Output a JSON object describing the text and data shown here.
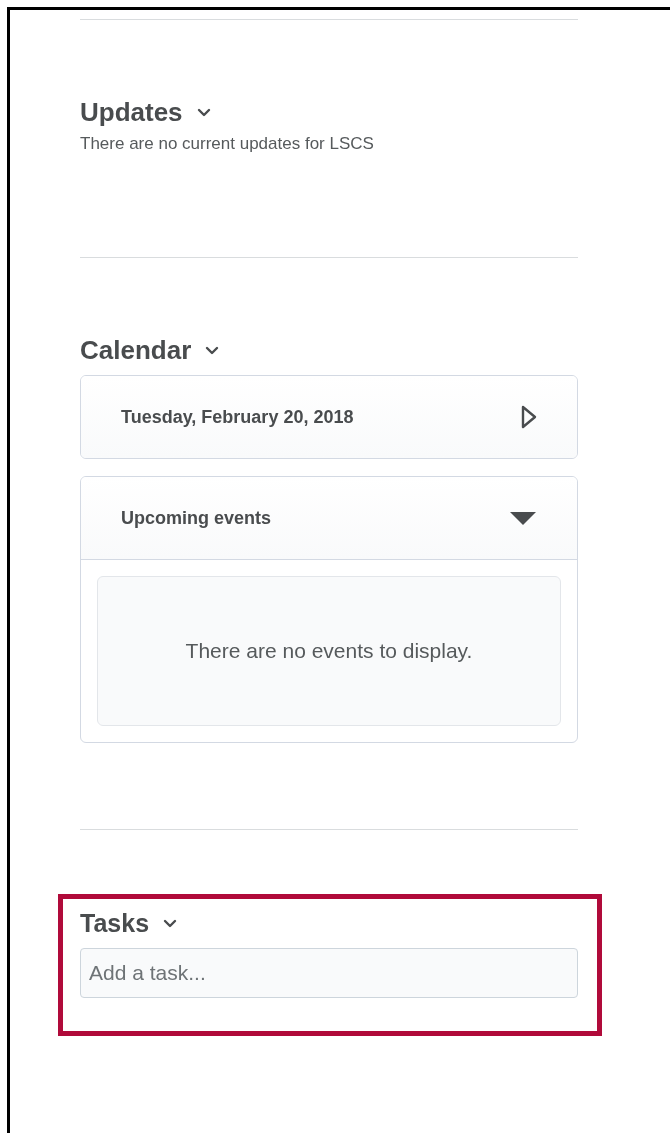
{
  "sections": [
    {
      "kind": "updates",
      "title": "Updates",
      "highlighted": false,
      "message": "There are no current updates for LSCS"
    },
    {
      "kind": "calendar",
      "title": "Calendar",
      "highlighted": false,
      "date": "Tuesday, February 20, 2018",
      "upcoming": {
        "label": "Upcoming events",
        "expanded": true,
        "empty_message": "There are no events to display."
      }
    },
    {
      "kind": "tasks",
      "title": "Tasks",
      "highlighted": true,
      "placeholder": "Add a task..."
    }
  ]
}
